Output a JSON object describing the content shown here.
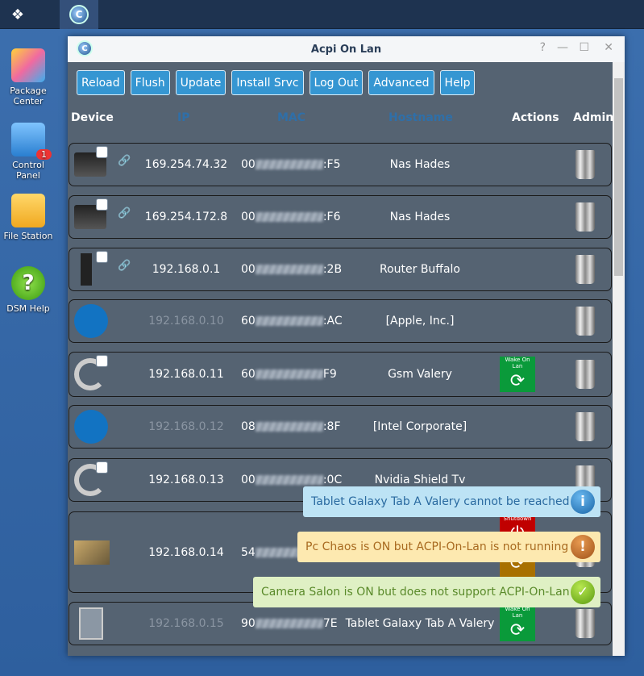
{
  "taskbar": {
    "main_menu_icon": "grid-icon",
    "app_icon": "acpi-on-lan-icon"
  },
  "desktop": [
    {
      "label": "Package Center",
      "icon": "package-center-icon"
    },
    {
      "label": "Control Panel",
      "icon": "control-panel-icon",
      "badge": "1"
    },
    {
      "label": "File Station",
      "icon": "folder-icon"
    },
    {
      "label": "DSM Help",
      "icon": "help-icon",
      "glyph": "?"
    }
  ],
  "window": {
    "title": "Acpi On Lan",
    "controls": {
      "help": "?",
      "minimize": "—",
      "maximize": "☐",
      "close": "✕"
    }
  },
  "toolbar": [
    "Reload",
    "Flush",
    "Update",
    "Install Srvc",
    "Log Out",
    "Advanced",
    "Help"
  ],
  "columns": {
    "device": "Device",
    "ip": "IP",
    "mac": "MAC",
    "hostname": "Hostname",
    "actions": "Actions",
    "admin": "Admin"
  },
  "rows": [
    {
      "ip": "169.254.74.32",
      "mac_prefix": "00",
      "mac_suffix": ":F5",
      "hostname": "Nas Hades",
      "device": "nas",
      "online": true
    },
    {
      "ip": "169.254.172.8",
      "mac_prefix": "00",
      "mac_suffix": ":F6",
      "hostname": "Nas Hades",
      "device": "nas",
      "online": true
    },
    {
      "ip": "192.168.0.1",
      "mac_prefix": "00",
      "mac_suffix": ":2B",
      "hostname": "Router Buffalo",
      "device": "router",
      "online": true
    },
    {
      "ip": "192.168.0.10",
      "mac_prefix": "60",
      "mac_suffix": ":AC",
      "hostname": "[Apple, Inc.]",
      "device": "unknown",
      "online": false
    },
    {
      "ip": "192.168.0.11",
      "mac_prefix": "60",
      "mac_suffix": "F9",
      "hostname": "Gsm Valery",
      "device": "android",
      "online": true,
      "action": "Wake On Lan"
    },
    {
      "ip": "192.168.0.12",
      "mac_prefix": "08",
      "mac_suffix": ":8F",
      "hostname": "[Intel Corporate]",
      "device": "unknown",
      "online": false
    },
    {
      "ip": "192.168.0.13",
      "mac_prefix": "00",
      "mac_suffix": ":0C",
      "hostname": "Nvidia Shield Tv",
      "device": "android",
      "online": true
    },
    {
      "ip": "192.168.0.14",
      "mac_prefix": "54",
      "mac_suffix": "",
      "hostname": "",
      "device": "laptop",
      "online": true,
      "action": "Shutdown"
    },
    {
      "ip": "192.168.0.15",
      "mac_prefix": "90",
      "mac_suffix": "7E",
      "hostname": "Tablet Galaxy Tab A Valery",
      "device": "tablet",
      "online": false,
      "action": "Wake On Lan"
    }
  ],
  "notifications": [
    {
      "type": "info",
      "text": "Tablet Galaxy Tab A Valery cannot be reached",
      "glyph": "i"
    },
    {
      "type": "warning",
      "text": "Pc Chaos is ON but ACPI-On-Lan is not running",
      "glyph": "!"
    },
    {
      "type": "success",
      "text": "Camera Salon is ON but does not support ACPI-On-Lan",
      "glyph": "✓"
    }
  ],
  "colors": {
    "button": "#3596d2",
    "window_bg": "#556372",
    "wake": "#0a9a3a",
    "shutdown": "#c00000",
    "info": "#bde3f5",
    "warning": "#fde9b0",
    "success": "#dff0c4"
  }
}
